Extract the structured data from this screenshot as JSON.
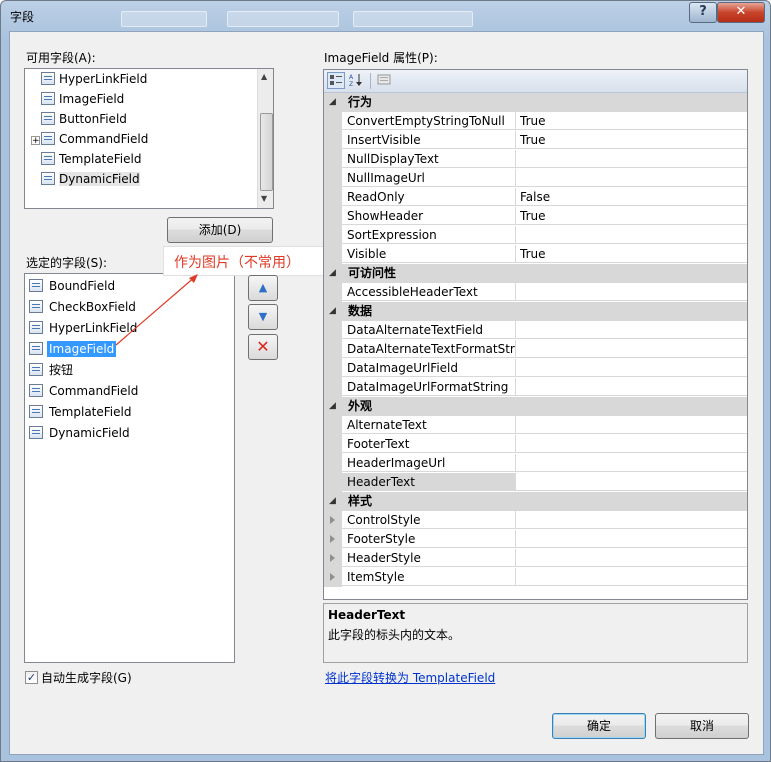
{
  "window": {
    "title": "字段",
    "help_label": "?",
    "close_label": "✕"
  },
  "available": {
    "label": "可用字段(A):",
    "items": [
      {
        "label": "HyperLinkField",
        "icon": "hyperlink-field-icon"
      },
      {
        "label": "ImageField",
        "icon": "image-field-icon"
      },
      {
        "label": "ButtonField",
        "icon": "button-field-icon"
      },
      {
        "label": "CommandField",
        "icon": "command-field-icon",
        "expander": "+"
      },
      {
        "label": "TemplateField",
        "icon": "template-field-icon"
      },
      {
        "label": "DynamicField",
        "icon": "dynamic-field-icon"
      }
    ],
    "add_label": "添加(D)"
  },
  "selected": {
    "label": "选定的字段(S):",
    "items": [
      {
        "label": "BoundField",
        "icon": "bound-field-icon"
      },
      {
        "label": "CheckBoxField",
        "icon": "checkbox-field-icon"
      },
      {
        "label": "HyperLinkField",
        "icon": "hyperlink-field-icon"
      },
      {
        "label": "ImageField",
        "icon": "image-field-icon",
        "selected": true
      },
      {
        "label": "按钮",
        "icon": "button-field-icon"
      },
      {
        "label": "CommandField",
        "icon": "command-field-icon"
      },
      {
        "label": "TemplateField",
        "icon": "template-field-icon"
      },
      {
        "label": "DynamicField",
        "icon": "dynamic-field-icon"
      }
    ]
  },
  "callout": {
    "text": "作为图片（不常用）",
    "color": "#e03a26"
  },
  "move_buttons": {
    "up_icon": "move-up-icon",
    "down_icon": "move-down-icon",
    "delete_icon": "delete-icon"
  },
  "properties": {
    "label": "ImageField 属性(P):",
    "categories": [
      {
        "name": "行为",
        "rows": [
          {
            "name": "ConvertEmptyStringToNull",
            "value": "True"
          },
          {
            "name": "InsertVisible",
            "value": "True"
          },
          {
            "name": "NullDisplayText",
            "value": ""
          },
          {
            "name": "NullImageUrl",
            "value": ""
          },
          {
            "name": "ReadOnly",
            "value": "False"
          },
          {
            "name": "ShowHeader",
            "value": "True"
          },
          {
            "name": "SortExpression",
            "value": ""
          },
          {
            "name": "Visible",
            "value": "True"
          }
        ]
      },
      {
        "name": "可访问性",
        "rows": [
          {
            "name": "AccessibleHeaderText",
            "value": ""
          }
        ]
      },
      {
        "name": "数据",
        "rows": [
          {
            "name": "DataAlternateTextField",
            "value": ""
          },
          {
            "name": "DataAlternateTextFormatString",
            "value": ""
          },
          {
            "name": "DataImageUrlField",
            "value": ""
          },
          {
            "name": "DataImageUrlFormatString",
            "value": ""
          }
        ]
      },
      {
        "name": "外观",
        "rows": [
          {
            "name": "AlternateText",
            "value": ""
          },
          {
            "name": "FooterText",
            "value": ""
          },
          {
            "name": "HeaderImageUrl",
            "value": ""
          },
          {
            "name": "HeaderText",
            "value": "",
            "selected": true
          }
        ]
      },
      {
        "name": "样式",
        "rows": [
          {
            "name": "ControlStyle",
            "value": "",
            "expandable": true
          },
          {
            "name": "FooterStyle",
            "value": "",
            "expandable": true
          },
          {
            "name": "HeaderStyle",
            "value": "",
            "expandable": true
          },
          {
            "name": "ItemStyle",
            "value": "",
            "expandable": true
          }
        ]
      }
    ],
    "description": {
      "title": "HeaderText",
      "text": "此字段的标头内的文本。"
    }
  },
  "auto_generate": {
    "label": "自动生成字段(G)",
    "checked": true
  },
  "convert_link": "将此字段转换为 TemplateField",
  "ok_label": "确定",
  "cancel_label": "取消"
}
